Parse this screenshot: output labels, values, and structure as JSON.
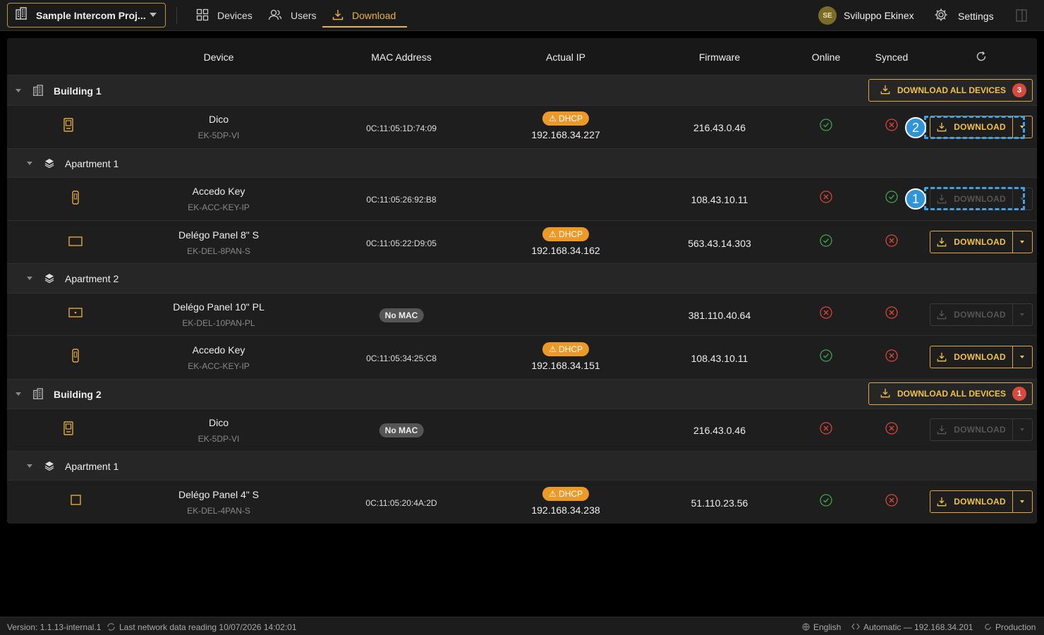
{
  "topbar": {
    "project_name": "Sample Intercom Proj...",
    "nav": {
      "devices": "Devices",
      "users": "Users",
      "download": "Download"
    },
    "user": {
      "initials": "SE",
      "name": "Sviluppo Ekinex"
    },
    "settings": "Settings"
  },
  "table": {
    "headers": {
      "device": "Device",
      "mac": "MAC Address",
      "ip": "Actual IP",
      "firmware": "Firmware",
      "online": "Online",
      "synced": "Synced"
    },
    "download_label": "DOWNLOAD",
    "download_all_label": "DOWNLOAD ALL DEVICES",
    "dhcp_label": "DHCP",
    "no_mac_label": "No MAC",
    "rows": {
      "b1": {
        "label": "Building 1",
        "badge": "3"
      },
      "b1d1": {
        "name": "Dico",
        "code": "EK-5DP-VI",
        "mac": "0C:11:05:1D:74:09",
        "ip": "192.168.34.227",
        "fw": "216.43.0.46",
        "online": true,
        "synced": false
      },
      "b1a1": {
        "label": "Apartment 1"
      },
      "b1a1d1": {
        "name": "Accedo Key",
        "code": "EK-ACC-KEY-IP",
        "mac": "0C:11:05:26:92:B8",
        "fw": "108.43.10.11",
        "online": false,
        "synced": true
      },
      "b1a1d2": {
        "name": "Delégo Panel 8\" S",
        "code": "EK-DEL-8PAN-S",
        "mac": "0C:11:05:22:D9:05",
        "ip": "192.168.34.162",
        "fw": "563.43.14.303",
        "online": true,
        "synced": false
      },
      "b1a2": {
        "label": "Apartment 2"
      },
      "b1a2d1": {
        "name": "Delégo Panel 10\" PL",
        "code": "EK-DEL-10PAN-PL",
        "fw": "381.110.40.64",
        "online": false,
        "synced": false
      },
      "b1a2d2": {
        "name": "Accedo Key",
        "code": "EK-ACC-KEY-IP",
        "mac": "0C:11:05:34:25:C8",
        "ip": "192.168.34.151",
        "fw": "108.43.10.11",
        "online": true,
        "synced": false
      },
      "b2": {
        "label": "Building 2",
        "badge": "1"
      },
      "b2d1": {
        "name": "Dico",
        "code": "EK-5DP-VI",
        "fw": "216.43.0.46",
        "online": false,
        "synced": false
      },
      "b2a1": {
        "label": "Apartment 1"
      },
      "b2a1d1": {
        "name": "Delégo Panel 4\" S",
        "code": "EK-DEL-4PAN-S",
        "mac": "0C:11:05:20:4A:2D",
        "ip": "192.168.34.238",
        "fw": "51.110.23.56",
        "online": true,
        "synced": false
      }
    }
  },
  "markers": {
    "m1": "1",
    "m2": "2"
  },
  "statusbar": {
    "version": "Version: 1.1.13-internal.1",
    "last_reading": "Last network data reading 10/07/2026 14:02:01",
    "language": "English",
    "network": "Automatic — 192.168.34.201",
    "environment": "Production"
  },
  "colors": {
    "accent": "#e9b43c",
    "online_ok": "#3fa34d",
    "error": "#d9443a",
    "marker": "#2f95d8"
  }
}
